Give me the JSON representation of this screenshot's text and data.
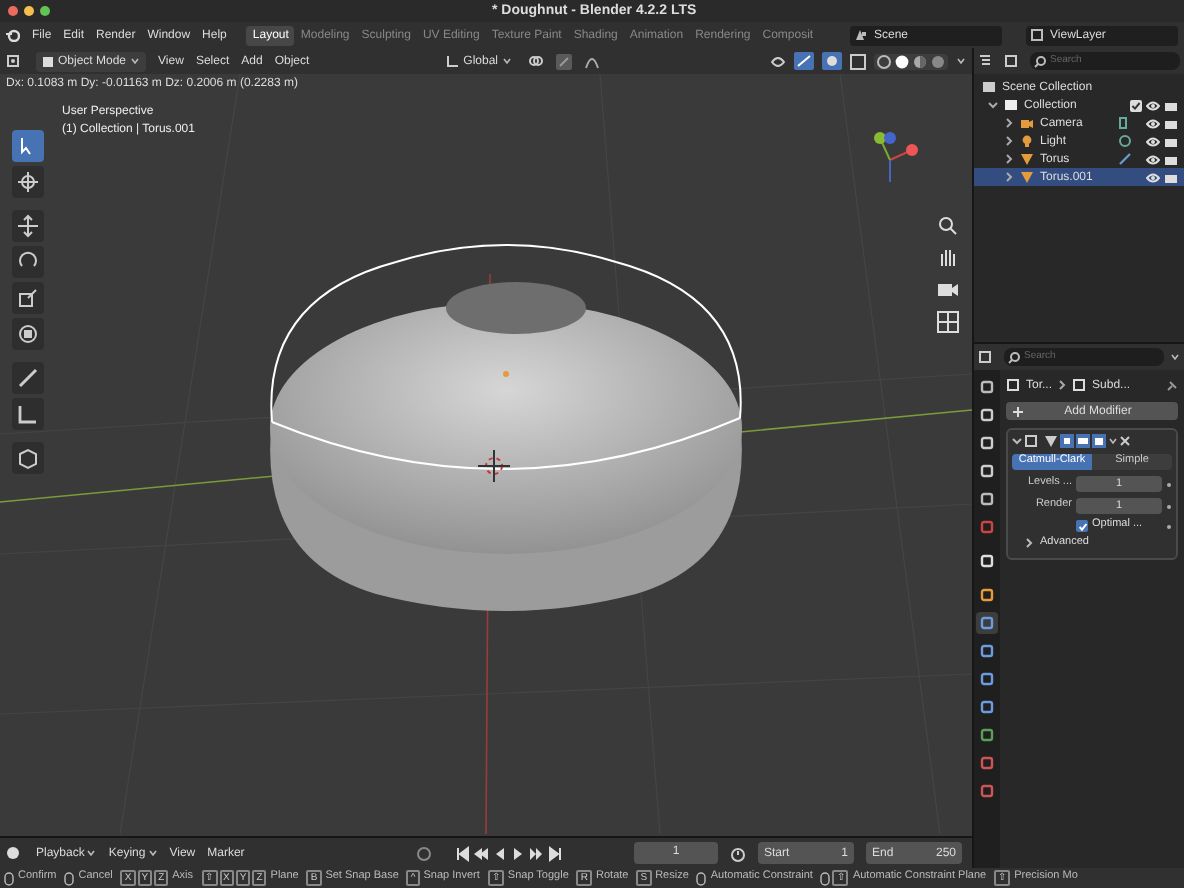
{
  "window": {
    "title": "* Doughnut - Blender 4.2.2 LTS"
  },
  "menu": [
    "File",
    "Edit",
    "Render",
    "Window",
    "Help"
  ],
  "workspace_tabs": [
    {
      "label": "Layout",
      "selected": true
    },
    {
      "label": "Modeling",
      "selected": false
    },
    {
      "label": "Sculpting",
      "selected": false
    },
    {
      "label": "UV Editing",
      "selected": false
    },
    {
      "label": "Texture Paint",
      "selected": false
    },
    {
      "label": "Shading",
      "selected": false
    },
    {
      "label": "Animation",
      "selected": false
    },
    {
      "label": "Rendering",
      "selected": false
    },
    {
      "label": "Composit",
      "selected": false
    }
  ],
  "scene": "Scene",
  "view_layer": "ViewLayer",
  "viewport": {
    "mode": "Object Mode",
    "menus": [
      "View",
      "Select",
      "Add",
      "Object"
    ],
    "orientation": "Global",
    "readout": "Dx: 0.1083 m  Dy: -0.01163 m  Dz: 0.2006 m (0.2283 m)",
    "overlay": [
      "User Perspective",
      "(1) Collection | Torus.001"
    ],
    "tools": [
      {
        "kind": "select",
        "selected": true
      },
      {
        "kind": "cursor",
        "selected": false
      },
      {
        "kind": "move",
        "selected": false
      },
      {
        "kind": "rotate",
        "selected": false
      },
      {
        "kind": "scale",
        "selected": false
      },
      {
        "kind": "transform",
        "selected": false
      },
      {
        "kind": "annotate",
        "selected": false
      },
      {
        "kind": "measure",
        "selected": false
      },
      {
        "kind": "cube",
        "selected": false
      }
    ]
  },
  "outliner": {
    "search": {
      "placeholder": "Search"
    },
    "root": "Scene Collection",
    "tree": [
      {
        "label": "Collection",
        "kind": "collection",
        "selected": false,
        "expanded": true,
        "children": [
          {
            "label": "Camera",
            "kind": "camera",
            "selected": false,
            "expanded": false
          },
          {
            "label": "Light",
            "kind": "light",
            "selected": false,
            "expanded": false
          },
          {
            "label": "Torus",
            "kind": "mesh",
            "selected": false,
            "expanded": false
          },
          {
            "label": "Torus.001",
            "kind": "mesh",
            "selected": true,
            "expanded": false
          }
        ]
      }
    ]
  },
  "properties": {
    "search": {
      "placeholder": "Search"
    },
    "breadcrumb": [
      "Tor...",
      "Subd..."
    ],
    "add_modifier": "Add Modifier",
    "tabs": [
      {
        "kind": "tool",
        "selected": false
      },
      {
        "kind": "render",
        "selected": false
      },
      {
        "kind": "output",
        "selected": false
      },
      {
        "kind": "view",
        "selected": false
      },
      {
        "kind": "scene",
        "selected": false
      },
      {
        "kind": "world",
        "selected": false
      },
      {
        "kind": "collection",
        "selected": false
      },
      {
        "kind": "object",
        "selected": false
      },
      {
        "kind": "modifier",
        "selected": true
      },
      {
        "kind": "particles",
        "selected": false
      },
      {
        "kind": "physics",
        "selected": false
      },
      {
        "kind": "constraints",
        "selected": false
      },
      {
        "kind": "data",
        "selected": false
      },
      {
        "kind": "material",
        "selected": false
      },
      {
        "kind": "texture",
        "selected": false
      }
    ],
    "modifier": {
      "types": [
        {
          "label": "Catmull-Clark",
          "selected": true
        },
        {
          "label": "Simple",
          "selected": false
        }
      ],
      "fields": [
        {
          "label": "Levels ...",
          "value": "1"
        },
        {
          "label": "Render",
          "value": "1"
        }
      ],
      "optimal": {
        "label": "Optimal ...",
        "checked": true
      },
      "advanced": {
        "label": "Advanced",
        "expanded": false
      }
    }
  },
  "timeline": {
    "menus": [
      "Playback",
      "Keying",
      "View",
      "Marker"
    ],
    "frame": "1",
    "start_label": "Start",
    "start": "1",
    "end_label": "End",
    "end": "250"
  },
  "status_bar": [
    {
      "mouse": true,
      "label": "Confirm"
    },
    {
      "mouse": true,
      "label": "Cancel"
    },
    {
      "mouse": false,
      "keys": [
        "X",
        "Y",
        "Z"
      ],
      "label": "Axis"
    },
    {
      "mouse": false,
      "keys": [
        "⇧",
        "X",
        "Y",
        "Z"
      ],
      "label": "Plane"
    },
    {
      "mouse": false,
      "keys": [
        "B"
      ],
      "label": "Set Snap Base"
    },
    {
      "mouse": false,
      "keys": [
        "^"
      ],
      "label": "Snap Invert"
    },
    {
      "mouse": false,
      "keys": [
        "⇧"
      ],
      "label": "Snap Toggle"
    },
    {
      "mouse": false,
      "keys": [
        "R"
      ],
      "label": "Rotate"
    },
    {
      "mouse": false,
      "keys": [
        "S"
      ],
      "label": "Resize"
    },
    {
      "mouse": true,
      "label": "Automatic Constraint"
    },
    {
      "mouse": true,
      "keys": [
        "⇧"
      ],
      "label": "Automatic Constraint Plane"
    },
    {
      "mouse": false,
      "keys": [
        "⇧"
      ],
      "label": "Precision Mo"
    }
  ]
}
